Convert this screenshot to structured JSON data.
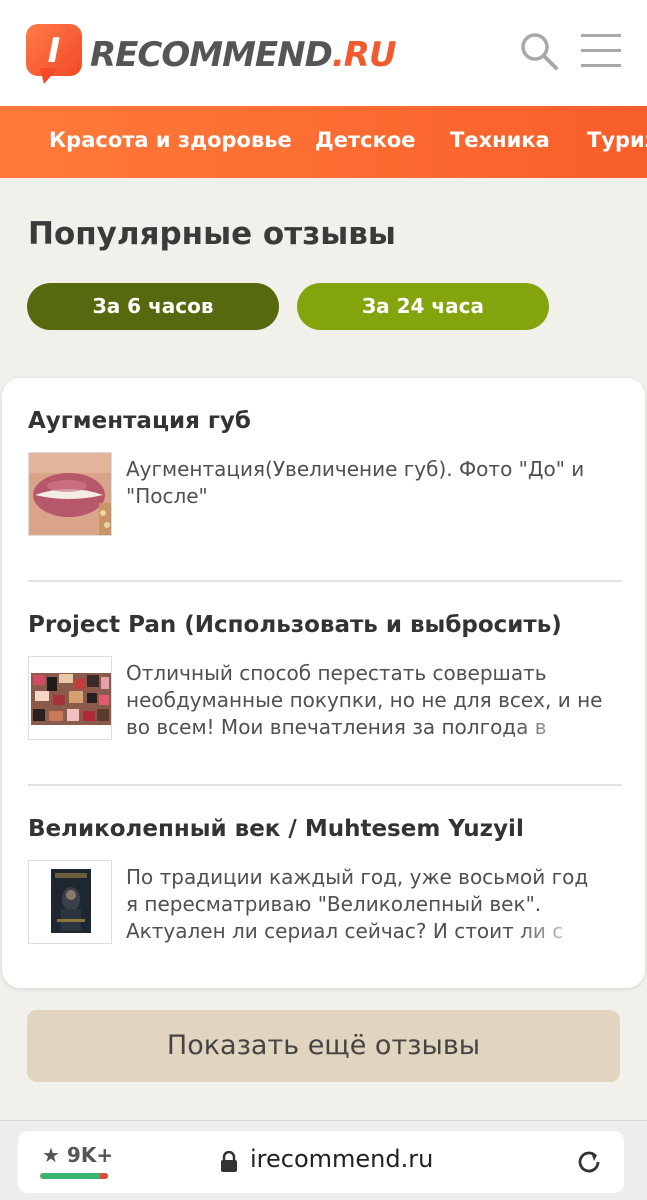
{
  "header": {
    "logo_letter": "I",
    "logo_name": "RECOMMEND",
    "logo_tld": ".RU",
    "brand_color": "#f05a2c"
  },
  "categories": [
    "Красота и здоровье",
    "Детское",
    "Техника",
    "Туризм"
  ],
  "section": {
    "title": "Популярные отзывы",
    "periods": [
      "За 6 часов",
      "За 24 часа"
    ]
  },
  "reviews": [
    {
      "title": "Аугментация губ",
      "text": "Аугментация(Увеличение губ). Фото \"До\" и \"После\""
    },
    {
      "title": "Project Pan (Использовать и выбросить)",
      "text": "Отличный способ перестать совершать необдуманные покупки, но не для всех, и не во всем! Мои впечатления за полгода в"
    },
    {
      "title": "Великолепный век / Muhtesem Yuzyil",
      "text": "По традиции каждый год, уже восьмой год я пересматриваю \"Великолепный век\". Актуален ли сериал сейчас? И стоит ли с"
    }
  ],
  "show_more_label": "Показать ещё отзывы",
  "browser": {
    "rating": "9K+",
    "url": "irecommend.ru"
  }
}
